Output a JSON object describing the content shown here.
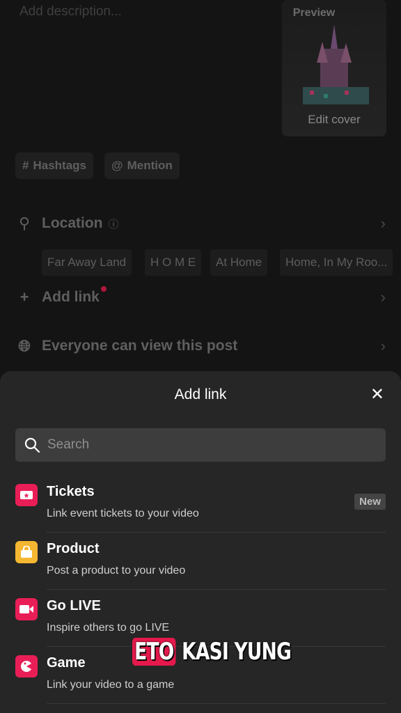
{
  "description_placeholder": "Add description...",
  "cover": {
    "preview_label": "Preview",
    "edit_label": "Edit cover"
  },
  "chips": {
    "hashtags": "Hashtags",
    "mention": "Mention"
  },
  "location": {
    "label": "Location",
    "suggestions": [
      "Far Away Land",
      "H O M E",
      "At Home",
      "Home, In My Roo..."
    ]
  },
  "add_link_row": {
    "label": "Add link"
  },
  "privacy_row": {
    "label": "Everyone can view this post"
  },
  "sheet": {
    "title": "Add link",
    "search_placeholder": "Search",
    "items": [
      {
        "title": "Tickets",
        "subtitle": "Link event tickets to your video",
        "badge": "New",
        "icon": "ticket-icon",
        "color": "#ea1e57"
      },
      {
        "title": "Product",
        "subtitle": "Post a product to your video",
        "icon": "shopping-bag-icon",
        "color": "#f5b731"
      },
      {
        "title": "Go LIVE",
        "subtitle": "Inspire others to go LIVE",
        "icon": "live-camera-icon",
        "color": "#ea1e57"
      },
      {
        "title": "Game",
        "subtitle": "Link your video to a game",
        "icon": "game-icon",
        "color": "#ea1e57"
      }
    ]
  },
  "caption_overlay": {
    "highlight": "ETO",
    "rest": "KASI YUNG"
  }
}
